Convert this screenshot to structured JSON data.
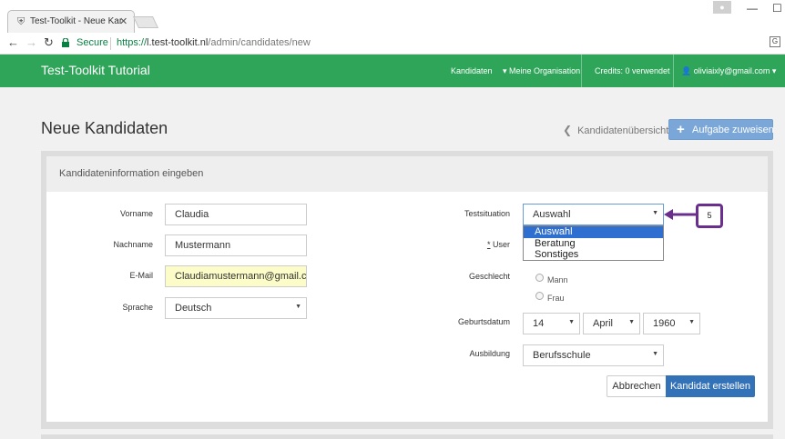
{
  "browser": {
    "tab_title": "Test-Toolkit - Neue Kandidaten",
    "secure_label": "Secure",
    "url_protocol": "https://",
    "url_host": "l.test-toolkit.nl",
    "url_path": "/admin/candidates/new"
  },
  "navbar": {
    "brand": "Test-Toolkit Tutorial",
    "kandidaten": "Kandidaten",
    "organisation": "Meine Organisation",
    "credits": "Credits: 0 verwendet",
    "user": "oliviaixly@gmail.com"
  },
  "page": {
    "title": "Neue Kandidaten",
    "back_link": "Kandidatenübersicht",
    "assign_button": "Aufgabe zuweisen"
  },
  "card": {
    "header": "Kandidateninformation eingeben"
  },
  "form": {
    "vorname_label": "Vorname",
    "vorname_value": "Claudia",
    "nachname_label": "Nachname",
    "nachname_value": "Mustermann",
    "email_label": "E-Mail",
    "email_value": "Claudiamustermann@gmail.com",
    "sprache_label": "Sprache",
    "sprache_value": "Deutsch",
    "testsituation_label": "Testsituation",
    "testsituation_value": "Auswahl",
    "testsituation_options": [
      "Auswahl",
      "Beratung",
      "Sonstiges"
    ],
    "user_required_mark": "*",
    "user_label": "User",
    "geschlecht_label": "Geschlecht",
    "gender_male": "Mann",
    "gender_female": "Frau",
    "geburtsdatum_label": "Geburtsdatum",
    "birth_day": "14",
    "birth_month": "April",
    "birth_year": "1960",
    "ausbildung_label": "Ausbildung",
    "ausbildung_value": "Berufsschule"
  },
  "actions": {
    "cancel": "Abbrechen",
    "create": "Kandidat erstellen"
  },
  "annotation": {
    "step": "5"
  },
  "colors": {
    "navbar": "#2fa55a",
    "primary": "#3472b8",
    "callout": "#6a2f8c",
    "dropdown_highlight": "#2f6fcf"
  }
}
